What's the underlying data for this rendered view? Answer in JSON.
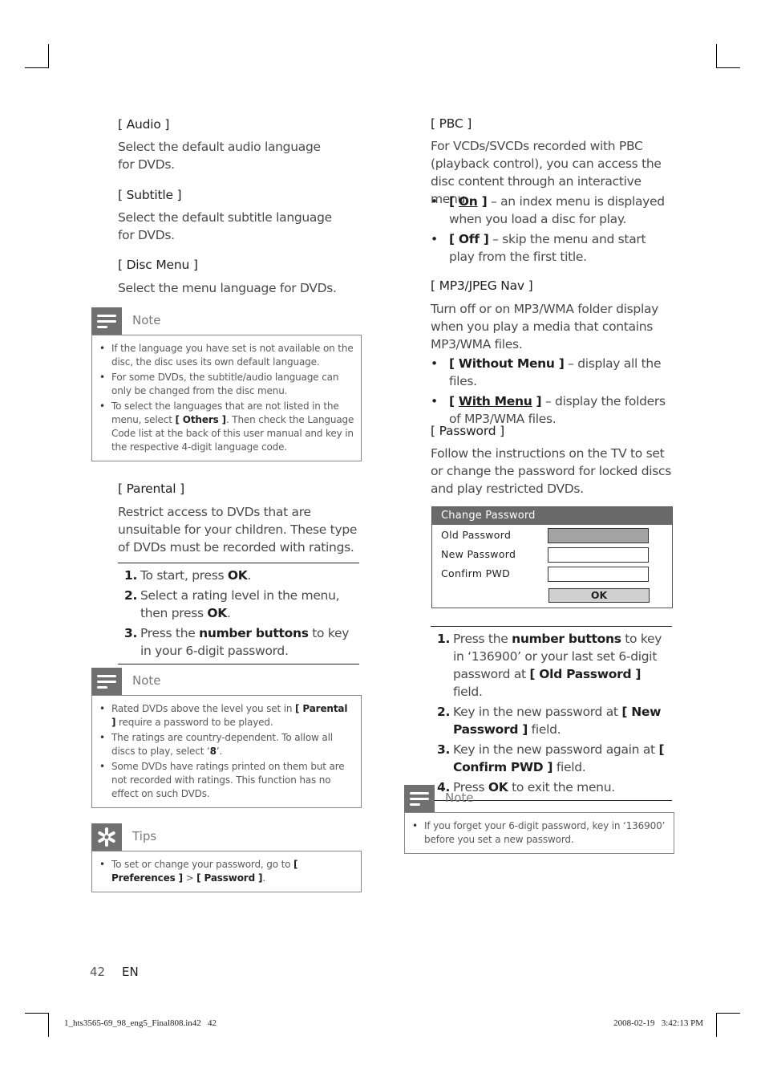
{
  "left_column": {
    "audio": {
      "heading": "[ Audio ]",
      "text": "Select the default audio language for DVDs."
    },
    "subtitle": {
      "heading": "[ Subtitle ]",
      "text": "Select the default subtitle language for DVDs."
    },
    "disc_menu": {
      "heading": "[ Disc Menu ]",
      "text": "Select the menu language for DVDs."
    },
    "note1": {
      "title": "Note",
      "icon": "note-icon",
      "items": [
        {
          "text": "If the language you have set is not available on the disc, the disc uses its own default language."
        },
        {
          "text": "For some DVDs, the subtitle/audio language can only be changed from the disc menu."
        },
        {
          "pre": "To select the languages that are not listed in the menu, select ",
          "bold": "[ Others ]",
          "post": ".  Then check the Language Code list at the back of this user manual and key in the respective 4-digit language code."
        }
      ]
    },
    "parental": {
      "heading": "[ Parental ]",
      "text": "Restrict access to DVDs that are unsuitable for your children.  These type of DVDs must be recorded with ratings.",
      "steps": [
        {
          "num": "1.",
          "pre": "To start, press ",
          "bold": "OK",
          "post": "."
        },
        {
          "num": "2.",
          "pre": "Select a rating level in the menu, then press ",
          "bold": "OK",
          "post": "."
        },
        {
          "num": "3.",
          "pre": "Press the ",
          "bold": "number buttons",
          "post": " to key in your 6-digit password."
        }
      ]
    },
    "note2": {
      "title": "Note",
      "icon": "note-icon",
      "items": [
        {
          "pre": "Rated DVDs above the level you set in ",
          "bold": "[ Parental ]",
          "post": " require a password to be played."
        },
        {
          "pre": "The ratings are country-dependent. To allow all discs to play, select ‘",
          "bold": "8",
          "post": "’."
        },
        {
          "pre": "Some DVDs have ratings printed on them but are not recorded with ratings.  This function has no effect on such DVDs.",
          "bold": "",
          "post": ""
        }
      ]
    },
    "tips": {
      "title": "Tips",
      "icon": "asterisk-icon",
      "items": [
        {
          "pre": "To set or change your password, go to ",
          "bold1": "[ Preferences ]",
          "sep": " > ",
          "bold2": "[ Password ]",
          "post": "."
        }
      ]
    }
  },
  "right_column": {
    "pbc": {
      "heading": "[ PBC ]",
      "text": "For VCDs/SVCDs recorded with PBC (playback control), you can access the disc content through an interactive menu.",
      "options": [
        {
          "open": "[ ",
          "label": "On",
          "close": " ]",
          "desc": " – an index menu is displayed when you load a disc for play.",
          "underlined": true
        },
        {
          "open": "[ ",
          "label": "Off",
          "close": " ]",
          "desc": " – skip the menu and start play from the first title.",
          "underlined": false
        }
      ]
    },
    "mp3_nav": {
      "heading": "[ MP3/JPEG Nav ]",
      "text": "Turn off or on MP3/WMA folder display when you play a media that contains MP3/WMA files.",
      "options": [
        {
          "open": "[ ",
          "label": "Without Menu",
          "close": " ]",
          "desc": " – display all the files.",
          "underlined": false
        },
        {
          "open": "[ ",
          "label": "With Menu",
          "close": " ]",
          "desc": " – display the folders of MP3/WMA files.",
          "underlined": true
        }
      ]
    },
    "password": {
      "heading": "[ Password ]",
      "text": "Follow the instructions on the TV to set or change the password for locked discs and play restricted DVDs.",
      "dialog": {
        "title": "Change Password",
        "fields": [
          {
            "label": "Old Password",
            "value": "",
            "active": true
          },
          {
            "label": "New Password",
            "value": "",
            "active": false
          },
          {
            "label": "Confirm PWD",
            "value": "",
            "active": false
          }
        ],
        "ok_label": "OK"
      },
      "steps": [
        {
          "num": "1.",
          "pre": "Press the ",
          "bold": "number buttons",
          "mid": " to key in ‘136900’ or your last set 6-digit password at ",
          "bold2": "[ Old Password ]",
          "post": " field."
        },
        {
          "num": "2.",
          "pre": "Key in the new password at ",
          "bold": "[ New Password ]",
          "mid": "",
          "bold2": "",
          "post": " field."
        },
        {
          "num": "3.",
          "pre": "Key in the new password again at ",
          "bold": "[ Confirm PWD ]",
          "mid": "",
          "bold2": "",
          "post": " field."
        },
        {
          "num": "4.",
          "pre": "Press ",
          "bold": "OK",
          "mid": "",
          "bold2": "",
          "post": " to exit the menu."
        }
      ]
    },
    "note3": {
      "title": "Note",
      "icon": "note-icon",
      "items": [
        {
          "text": "If you forget your 6-digit password, key in ‘136900’ before you set a new password."
        }
      ]
    }
  },
  "footer": {
    "page_number": "42",
    "language": "EN",
    "slug_file": "1_hts3565-69_98_eng5_Final808.in42   42",
    "slug_timestamp": "2008-02-19   3:42:13 PM"
  }
}
